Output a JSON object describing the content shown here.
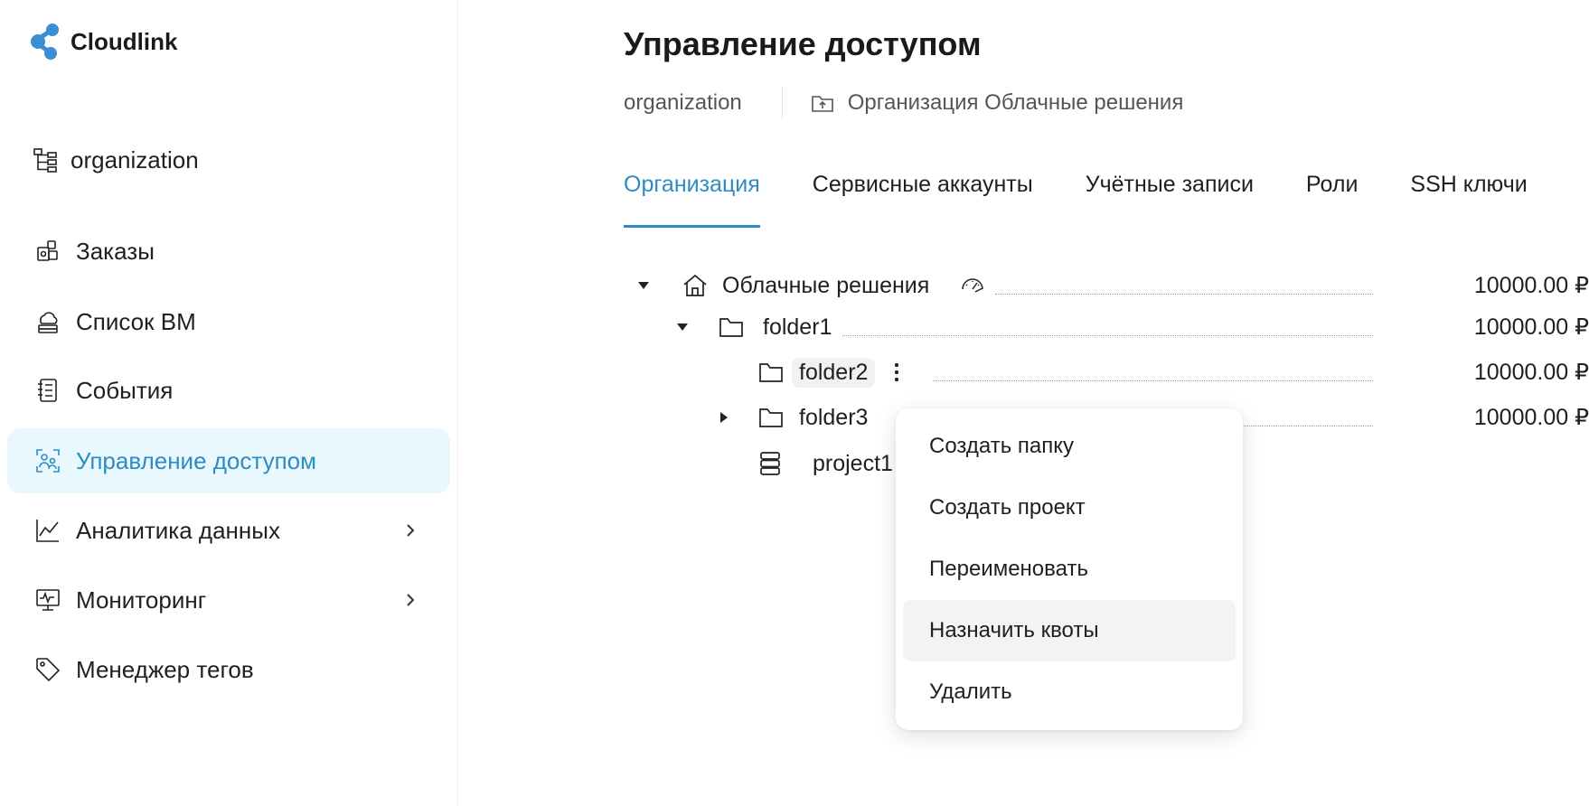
{
  "app": {
    "name": "Cloudlink",
    "brand_color": "#3a8fd4"
  },
  "sidebar": {
    "org_switch": {
      "label": "organization",
      "icon": "hierarchy-icon"
    },
    "items": [
      {
        "label": "Заказы",
        "icon": "orders-icon"
      },
      {
        "label": "Список ВМ",
        "icon": "cloud-server-icon"
      },
      {
        "label": "События",
        "icon": "events-list-icon"
      },
      {
        "label": "Управление доступом",
        "icon": "access-icon",
        "active": true
      },
      {
        "label": "Аналитика данных",
        "icon": "chart-icon",
        "has_children": true
      },
      {
        "label": "Мониторинг",
        "icon": "monitor-icon",
        "has_children": true
      },
      {
        "label": "Менеджер тегов",
        "icon": "tag-icon"
      }
    ],
    "active_color": "#2e8bc4",
    "active_bg": "#e8f8fd"
  },
  "page": {
    "title": "Управление доступом",
    "breadcrumb": {
      "root": "organization",
      "current": "Организация Облачные решения"
    },
    "tabs": [
      {
        "label": "Организация",
        "active": true
      },
      {
        "label": "Сервисные аккаунты"
      },
      {
        "label": "Учётные записи"
      },
      {
        "label": "Роли"
      },
      {
        "label": "SSH ключи"
      }
    ]
  },
  "tree": [
    {
      "label": "Облачные решения",
      "amount": "10000.00 ₽",
      "type": "root"
    },
    {
      "label": "folder1",
      "amount": "10000.00 ₽",
      "type": "folder"
    },
    {
      "label": "folder2",
      "amount": "10000.00 ₽",
      "type": "folder"
    },
    {
      "label": "folder3",
      "amount": "10000.00 ₽",
      "type": "folder"
    },
    {
      "label": "project1",
      "type": "project"
    }
  ],
  "context_menu": {
    "items": [
      {
        "label": "Создать папку"
      },
      {
        "label": "Создать проект"
      },
      {
        "label": "Переименовать"
      },
      {
        "label": "Назначить квоты",
        "hovered": true
      },
      {
        "label": "Удалить"
      }
    ]
  }
}
